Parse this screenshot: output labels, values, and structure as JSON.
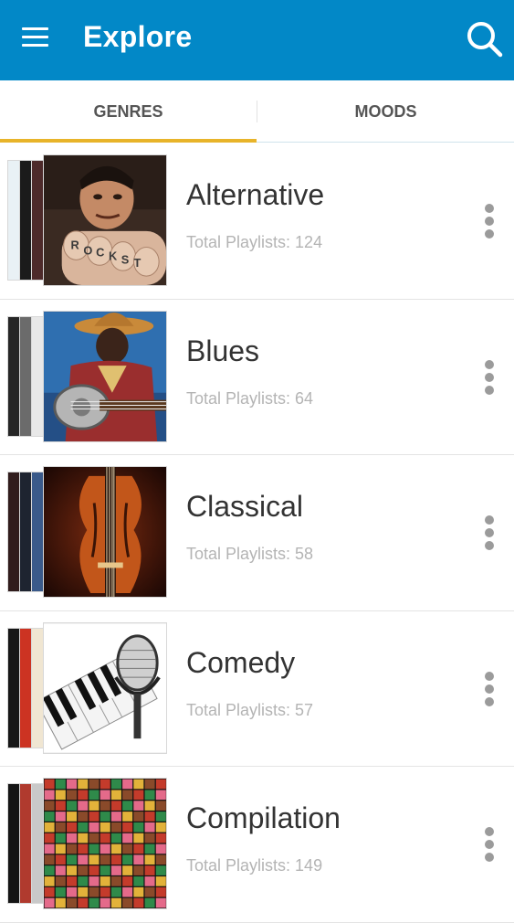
{
  "header": {
    "title": "Explore",
    "menu_icon": "hamburger-menu-icon",
    "search_icon": "search-icon",
    "background_color": "#0288c7"
  },
  "tabs": [
    {
      "label": "GENRES",
      "selected": true
    },
    {
      "label": "MOODS",
      "selected": false
    }
  ],
  "tab_indicator_color": "#e8b42a",
  "count_prefix": "Total Playlists: ",
  "genres": [
    {
      "name": "Alternative",
      "playlists": "124",
      "stack_colors": [
        "#e9f1f5",
        "#1b1b1b",
        "#4d2a2a"
      ],
      "cover_art": "rock-fist-photo"
    },
    {
      "name": "Blues",
      "playlists": "64",
      "stack_colors": [
        "#262626",
        "#6b6b6b",
        "#e8e8e8"
      ],
      "cover_art": "blues-guitar-illustration"
    },
    {
      "name": "Classical",
      "playlists": "58",
      "stack_colors": [
        "#301c1c",
        "#1e2430",
        "#3a5a8a"
      ],
      "cover_art": "violin-photo"
    },
    {
      "name": "Comedy",
      "playlists": "57",
      "stack_colors": [
        "#161616",
        "#cc3322",
        "#f0e6d2"
      ],
      "cover_art": "microphone-piano-keys"
    },
    {
      "name": "Compilation",
      "playlists": "149",
      "stack_colors": [
        "#151515",
        "#b03a2e",
        "#c9c9c9"
      ],
      "cover_art": "album-collage"
    }
  ]
}
